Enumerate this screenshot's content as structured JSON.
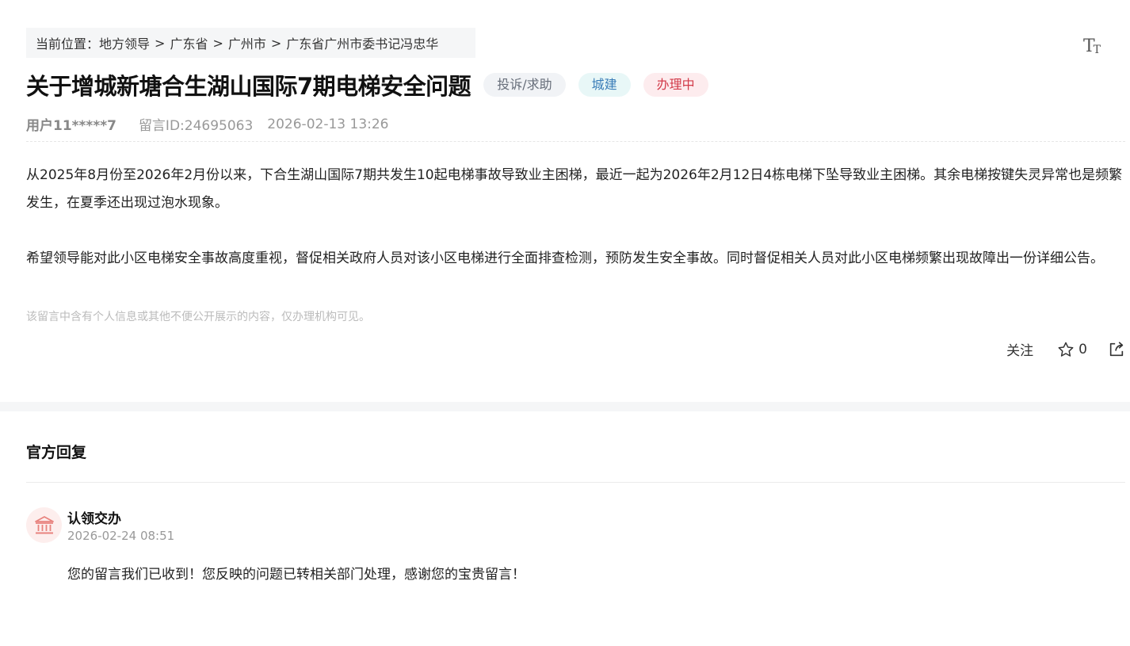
{
  "breadcrumb": {
    "prefix": "当前位置：",
    "items": [
      "地方领导",
      "广东省",
      "广州市",
      "广东省广州市委书记冯忠华"
    ],
    "separator": ">"
  },
  "font_toggle": {
    "icon": "font-size-icon"
  },
  "post": {
    "title": "关于增城新塘合生湖山国际7期电梯安全问题",
    "tags": [
      {
        "label": "投诉/求助",
        "color": "#666d79",
        "bg": "#f1f3f6"
      },
      {
        "label": "城建",
        "color": "#3a7db8",
        "bg": "#e8f7f7"
      },
      {
        "label": "办理中",
        "color": "#d23b4a",
        "bg": "#fdecee"
      }
    ],
    "user": "用户11*****7",
    "message_id": "留言ID:24695063",
    "datetime": "2026-02-13 13:26",
    "paragraphs": [
      "从2025年8月份至2026年2月份以来，下合生湖山国际7期共发生10起电梯事故导致业主困梯，最近一起为2026年2月12日4栋电梯下坠导致业主困梯。其余电梯按键失灵异常也是频繁发生，在夏季还出现过泡水现象。",
      "希望领导能对此小区电梯安全事故高度重视，督促相关政府人员对该小区电梯进行全面排查检测，预防发生安全事故。同时督促相关人员对此小区电梯频繁出现故障出一份详细公告。"
    ],
    "privacy_notice": "该留言中含有个人信息或其他不便公开展示的内容，仅办理机构可见。"
  },
  "actions": {
    "follow_label": "关注",
    "like_count": "0",
    "like_icon": "star-icon",
    "share_icon": "share-icon"
  },
  "reply": {
    "section_title": "官方回复",
    "org_icon": "government-building-icon",
    "org_name": "认领交办",
    "time": "2026-02-24 08:51",
    "text": "您的留言我们已收到！您反映的问题已转相关部门处理，感谢您的宝贵留言！"
  }
}
